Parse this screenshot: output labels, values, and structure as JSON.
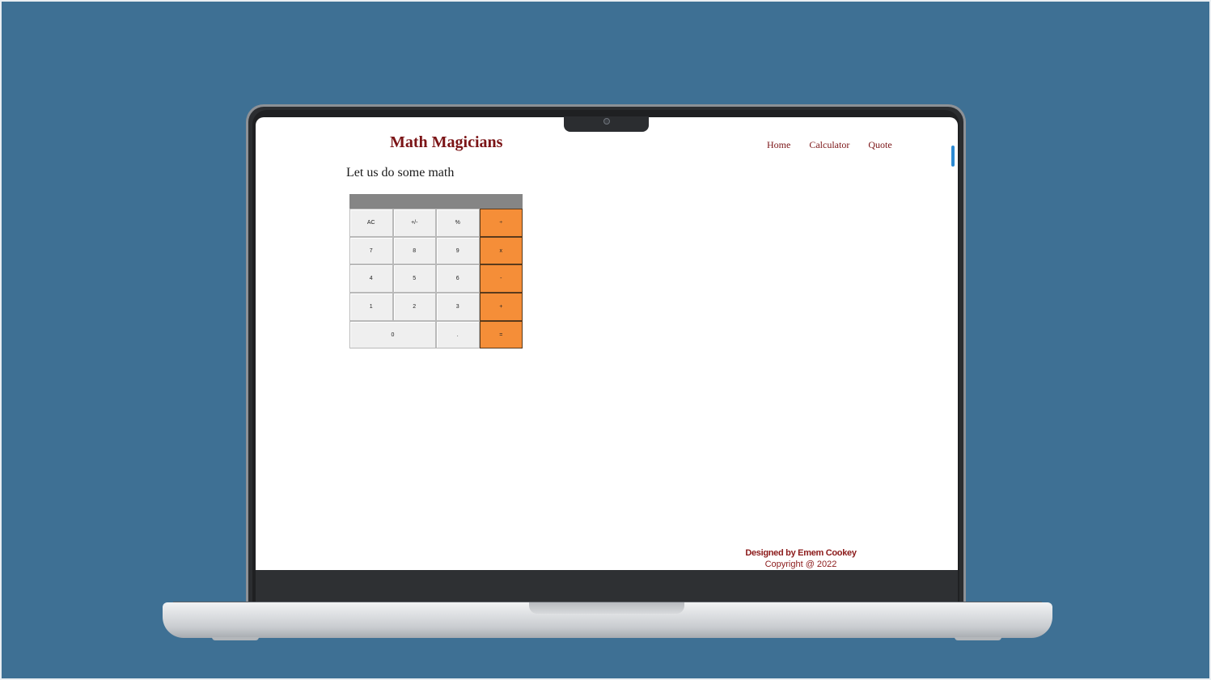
{
  "app": {
    "brand": "Math Magicians",
    "nav": [
      "Home",
      "Calculator",
      "Quote"
    ]
  },
  "page": {
    "heading": "Let us do some math"
  },
  "calculator": {
    "display": "",
    "keys": [
      {
        "label": "AC",
        "type": "function",
        "name": "key-clear"
      },
      {
        "label": "+/-",
        "type": "function",
        "name": "key-sign"
      },
      {
        "label": "%",
        "type": "function",
        "name": "key-percent"
      },
      {
        "label": "÷",
        "type": "operator",
        "name": "key-divide"
      },
      {
        "label": "7",
        "type": "digit",
        "name": "key-7"
      },
      {
        "label": "8",
        "type": "digit",
        "name": "key-8"
      },
      {
        "label": "9",
        "type": "digit",
        "name": "key-9"
      },
      {
        "label": "x",
        "type": "operator",
        "name": "key-multiply"
      },
      {
        "label": "4",
        "type": "digit",
        "name": "key-4"
      },
      {
        "label": "5",
        "type": "digit",
        "name": "key-5"
      },
      {
        "label": "6",
        "type": "digit",
        "name": "key-6"
      },
      {
        "label": "-",
        "type": "operator",
        "name": "key-subtract"
      },
      {
        "label": "1",
        "type": "digit",
        "name": "key-1"
      },
      {
        "label": "2",
        "type": "digit",
        "name": "key-2"
      },
      {
        "label": "3",
        "type": "digit",
        "name": "key-3"
      },
      {
        "label": "+",
        "type": "operator",
        "name": "key-add"
      },
      {
        "label": "0",
        "type": "digit",
        "name": "key-0",
        "wide": true
      },
      {
        "label": ".",
        "type": "digit",
        "name": "key-decimal"
      },
      {
        "label": "=",
        "type": "operator",
        "name": "key-equals"
      }
    ]
  },
  "footer": {
    "designed_by": "Designed by Emem Cookey",
    "copyright": "Copyright @ 2022"
  },
  "colors": {
    "background": "#3e7094",
    "brand": "#7b1416",
    "operator_key": "#f58e38",
    "display": "#858585"
  }
}
